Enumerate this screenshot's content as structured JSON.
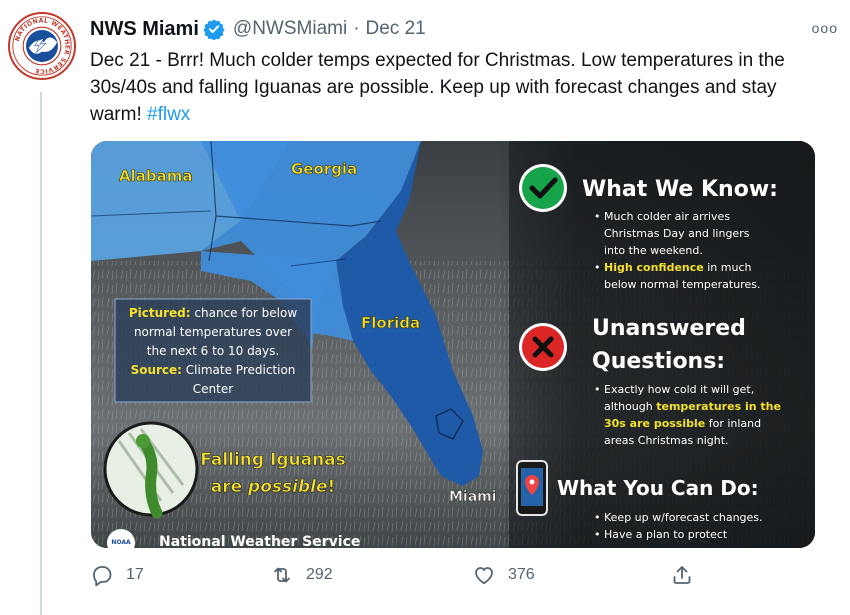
{
  "tweet": {
    "author_name": "NWS Miami",
    "handle": "@NWSMiami",
    "separator": "·",
    "date": "Dec 21",
    "more_label": "ooo",
    "text": "Dec 21 - Brrr! Much colder temps expected for Christmas. Low temperatures in the 30s/40s and falling Iguanas are possible. Keep up with forecast changes and stay warm! ",
    "hashtag": "#flwx"
  },
  "avatar": {
    "ring_text": "NATIONAL WEATHER SERVICE",
    "colors": {
      "ring": "#c0392b",
      "inner": "#1a4f9c"
    }
  },
  "image": {
    "map_labels": {
      "alabama": "Alabama",
      "georgia": "Georgia",
      "florida": "Florida",
      "miami": "Miami"
    },
    "info_box": {
      "line1_prefix": "Pictured:",
      "line1_rest": " chance for below",
      "line2": "normal temperatures over",
      "line3": "the next 6 to 10 days.",
      "line4_prefix": "Source:",
      "line4_rest": " Climate Prediction",
      "line5": "Center"
    },
    "iguana_line1": "Falling Iguanas",
    "iguana_line2_prefix": "are ",
    "iguana_line2_emph": "possible",
    "iguana_line2_suffix": "!",
    "footer_logo": "NOAA",
    "footer": "National Weather Service",
    "know": {
      "title": "What We Know:",
      "b1_l1": "Much colder air arrives",
      "b1_l2": "Christmas Day and lingers",
      "b1_l3": "into the weekend.",
      "b2_emph": "High confidence",
      "b2_rest": " in much",
      "b2_l2": "below normal temperatures."
    },
    "unanswered": {
      "title_l1": "Unanswered",
      "title_l2": "Questions:",
      "b1_l1": "Exactly how cold it will get,",
      "b1_l2_pre": "although ",
      "b1_l2_emph": "temperatures in the",
      "b1_l3_emph": "30s are possible",
      "b1_l3_rest": " for inland",
      "b1_l4": "areas Christmas night."
    },
    "cando": {
      "title": "What You Can Do:",
      "b1": "Keep up w/forecast changes.",
      "b2_l1": "Have a plan to protect"
    },
    "colors": {
      "below_light": "#5aa6e6",
      "below_mid": "#3f8ddb",
      "below_dark": "#1f5aa8",
      "green_icon": "#16a34a",
      "red_icon": "#dc2626",
      "highlight": "#f5e12b"
    }
  },
  "actions": {
    "reply": {
      "icon": "reply-icon",
      "count": "17"
    },
    "retweet": {
      "icon": "retweet-icon",
      "count": "292"
    },
    "like": {
      "icon": "heart-icon",
      "count": "376"
    },
    "share": {
      "icon": "share-icon"
    }
  }
}
